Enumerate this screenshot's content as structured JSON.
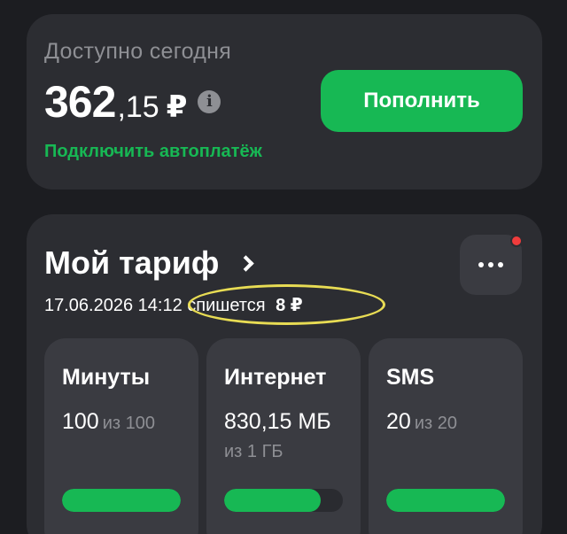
{
  "balance": {
    "label": "Доступно сегодня",
    "amount_int": "362",
    "amount_frac": ",15",
    "currency": "₽",
    "info_glyph": "i",
    "topup_label": "Пополнить",
    "autopay_link": "Подключить автоплатёж"
  },
  "tariff": {
    "title": "Мой тариф",
    "charge_datetime": "17.06.2026 14:12",
    "charge_text": "спишется",
    "charge_amount": "8 ₽",
    "highlight_color": "#e8dc54",
    "more_icon": "more-dots-icon",
    "tiles": [
      {
        "title": "Минуты",
        "value": "100",
        "of": "из 100",
        "sub": "",
        "progress": 1.0
      },
      {
        "title": "Интернет",
        "value": "830,15 МБ",
        "of": "",
        "sub": "из 1 ГБ",
        "progress": 0.81
      },
      {
        "title": "SMS",
        "value": "20",
        "of": "из 20",
        "sub": "",
        "progress": 1.0
      }
    ]
  },
  "colors": {
    "accent": "#17b854",
    "background": "#1c1d21",
    "card": "#2c2d32",
    "tile": "#3a3b41",
    "notification": "#f03c3c"
  }
}
